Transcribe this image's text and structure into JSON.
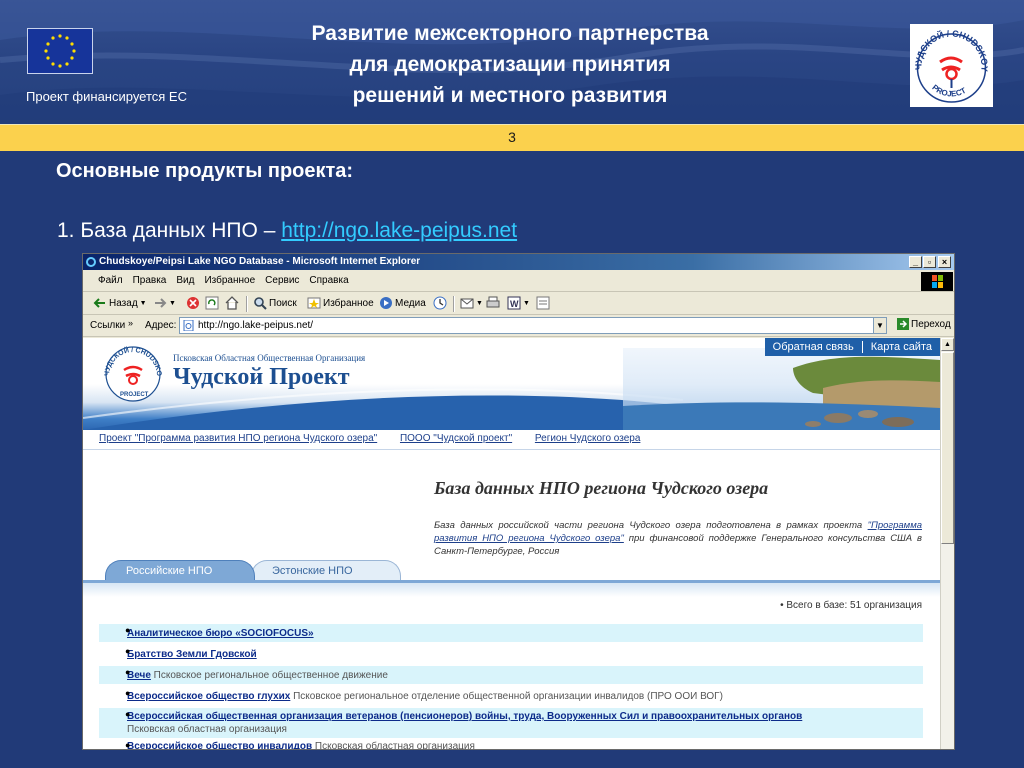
{
  "slide": {
    "eu_funded": "Проект финансируется ЕС",
    "title_lines": [
      "Развитие межсекторного партнерства",
      "для демократизации принятия",
      "решений и местного развития"
    ],
    "page_number": "3",
    "section_heading": "Основные продукты проекта:",
    "item_prefix": "1. База данных НПО – ",
    "item_link": "http://ngo.lake-peipus.net",
    "logo_text": "ЧУДСКОЙ / CHUDSKOYE PROJECT"
  },
  "browser": {
    "title": "Chudskoye/Peipsi Lake NGO Database - Microsoft Internet Explorer",
    "window_buttons": [
      "_",
      "▫",
      "×"
    ],
    "menu": [
      "Файл",
      "Правка",
      "Вид",
      "Избранное",
      "Сервис",
      "Справка"
    ],
    "toolbar": {
      "back": "Назад",
      "search": "Поиск",
      "favorites": "Избранное",
      "media": "Медиа"
    },
    "address": {
      "links_label": "Ссылки",
      "label": "Адрес:",
      "url": "http://ngo.lake-peipus.net/",
      "go": "Переход"
    }
  },
  "site": {
    "org_name": "Псковская Областная Общественная Организация",
    "site_name": "Чудской Проект",
    "topnav": [
      "Обратная связь",
      "Карта сайта"
    ],
    "links": [
      "Проект \"Программа развития НПО региона Чудского озера\"",
      "ПООО \"Чудской проект\"",
      "Регион Чудского озера"
    ],
    "db_title": "База данных НПО региона Чудского озера",
    "db_desc_before": "База данных российской части региона Чудского озера подготовлена в рамках проекта ",
    "db_desc_link": "\"Программа развития НПО региона Чудского озера\"",
    "db_desc_after": " при финансовой поддержке Генерального консульства США в Санкт-Петербурге, Россия",
    "tabs": [
      "Российские НПО",
      "Эстонские НПО"
    ],
    "total": "• Всего в базе: 51 организация",
    "ngos": [
      {
        "name": "Аналитическое бюро «SOCIOFOCUS»",
        "desc": ""
      },
      {
        "name": "Братство Земли Гдовской",
        "desc": ""
      },
      {
        "name": "Вече",
        "desc": " Псковское региональное общественное движение"
      },
      {
        "name": "Всероссийское общество глухих",
        "desc": " Псковское региональное отделение общественной организации инвалидов (ПРО ООИ ВОГ)"
      },
      {
        "name": "Всероссийская общественная организация ветеранов (пенсионеров) войны, труда, Вооруженных Сил и правоохранительных органов",
        "desc": "Псковская областная организация"
      },
      {
        "name": "Всероссийское общество инвалидов",
        "desc": " Псковская областная организация"
      }
    ]
  }
}
